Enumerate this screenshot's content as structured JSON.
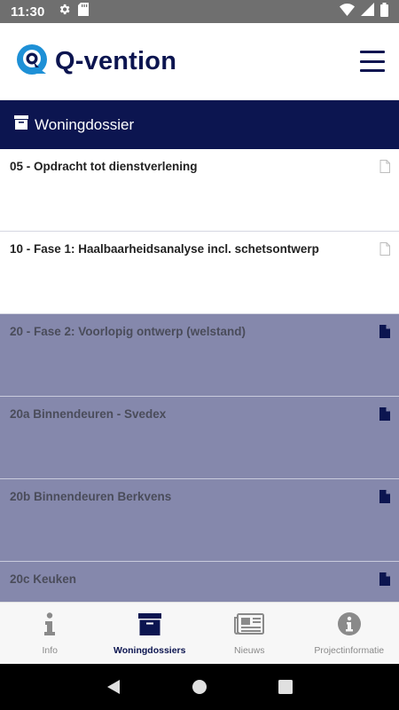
{
  "status_bar": {
    "time": "11:30",
    "icons": [
      "settings-icon",
      "sd-card-icon",
      "wifi-icon",
      "signal-icon",
      "battery-icon"
    ]
  },
  "header": {
    "logo_text": "Q-vention",
    "menu_icon": "hamburger-menu-icon"
  },
  "section": {
    "icon": "archive-box-icon",
    "title": "Woningdossier"
  },
  "dossiers": [
    {
      "title": "05 - Opdracht tot dienstverlening",
      "style": "light"
    },
    {
      "title": "10 - Fase 1: Haalbaarheidsanalyse incl. schetsontwerp",
      "style": "light"
    },
    {
      "title": "20 - Fase 2: Voorlopig ontwerp (welstand)",
      "style": "dark"
    },
    {
      "title": "20a Binnendeuren - Svedex",
      "style": "dark"
    },
    {
      "title": "20b Binnendeuren Berkvens",
      "style": "dark"
    },
    {
      "title": "20c Keuken",
      "style": "dark"
    }
  ],
  "bottom_nav": {
    "tabs": [
      {
        "label": "Info",
        "icon": "info-i-icon",
        "active": false
      },
      {
        "label": "Woningdossiers",
        "icon": "archive-box-icon",
        "active": true
      },
      {
        "label": "Nieuws",
        "icon": "newspaper-icon",
        "active": false
      },
      {
        "label": "Projectinformatie",
        "icon": "info-circle-icon",
        "active": false
      }
    ]
  },
  "colors": {
    "brand_navy": "#0c1550",
    "logo_blue": "#1e90d6",
    "dark_item_bg": "#8588ac",
    "status_bar": "#6f6f6f"
  }
}
